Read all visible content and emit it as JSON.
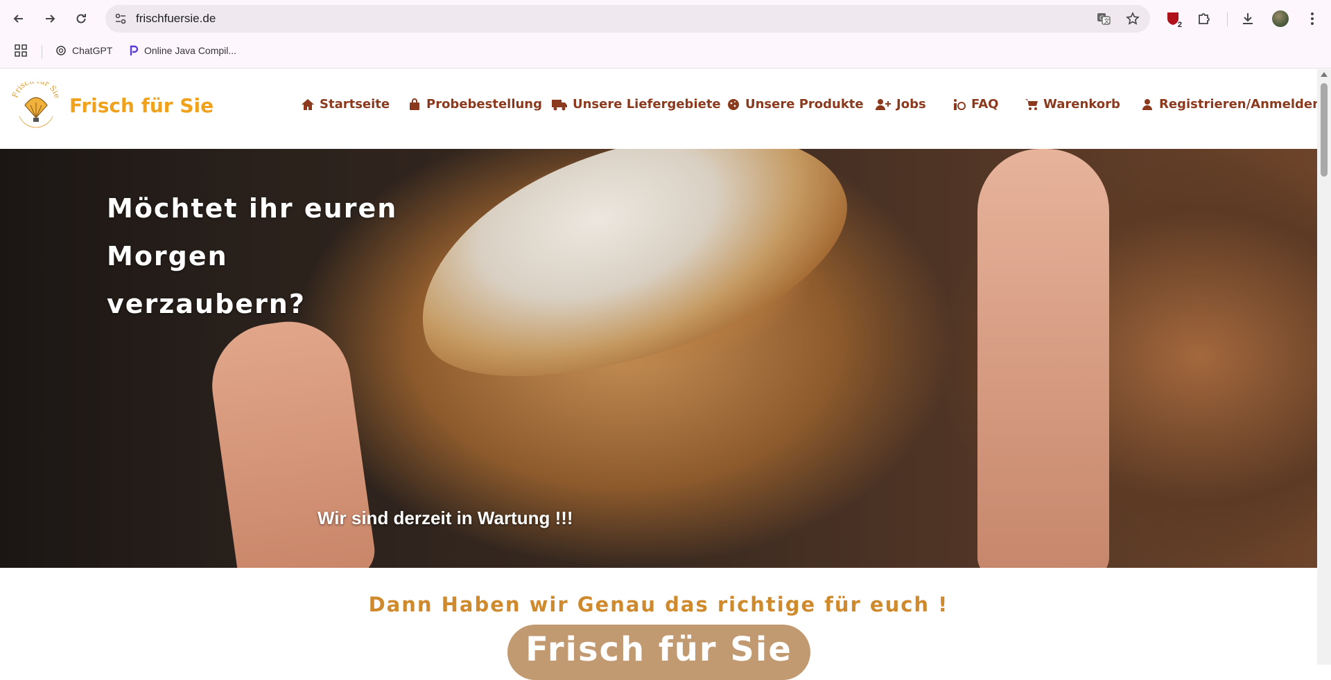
{
  "browser": {
    "url": "frischfuersie.de",
    "back_icon": "arrow-left-icon",
    "forward_icon": "arrow-right-icon",
    "reload_icon": "reload-icon",
    "site_info_icon": "tune-icon",
    "translate_icon": "translate-icon",
    "bookmark_icon": "star-icon",
    "extension_badge": "2",
    "bookmarks": [
      {
        "label": "ChatGPT",
        "icon": "openai-icon"
      },
      {
        "label": "Online Java Compil...",
        "icon": "p-logo-icon"
      }
    ]
  },
  "site": {
    "brand": "Frisch für Sie",
    "logo_text": "Frisch für Sie",
    "nav": [
      {
        "label": "Startseite",
        "icon": "home-icon"
      },
      {
        "label": "Probebestellung",
        "icon": "bag-icon"
      },
      {
        "label": "Unsere Liefergebiete",
        "icon": "truck-icon"
      },
      {
        "label": "Unsere Produkte",
        "icon": "cookie-icon"
      },
      {
        "label": "Jobs",
        "icon": "user-plus-icon"
      },
      {
        "label": "FAQ",
        "icon": "info-person-icon"
      },
      {
        "label": "Warenkorb",
        "icon": "cart-icon"
      },
      {
        "label": "Registrieren/Anmelden",
        "icon": "user-icon"
      }
    ],
    "hero": {
      "title_lines": [
        "Möchtet ihr euren",
        "Morgen",
        "verzaubern?"
      ],
      "note": "Wir sind derzeit in Wartung !!!"
    },
    "tagline": "Dann Haben wir Genau das richtige für euch !",
    "cta": "Frisch für Sie"
  },
  "colors": {
    "brand": "#f0a21c",
    "nav_text": "#8b3a1e",
    "tagline": "#d08a2e",
    "cta_bg": "#c29a72"
  }
}
